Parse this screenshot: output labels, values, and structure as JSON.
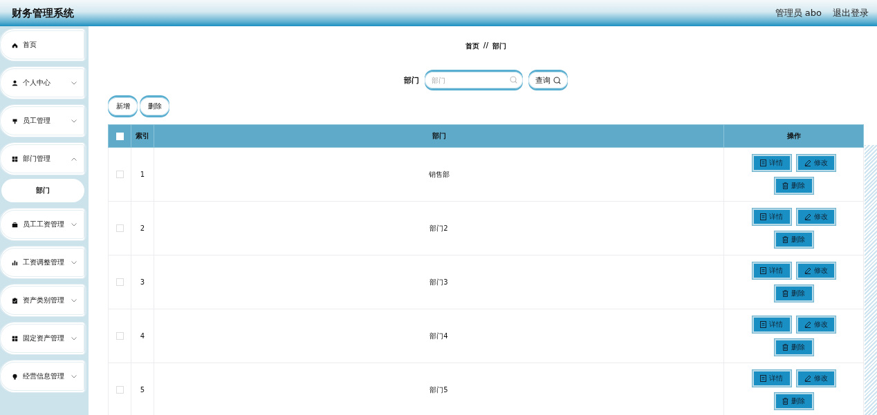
{
  "header": {
    "title": "财务管理系统",
    "user": "管理员 abo",
    "logout": "退出登录"
  },
  "sidebar": {
    "items": [
      {
        "label": "首页",
        "kind": "link",
        "selected": false
      },
      {
        "label": "个人中心",
        "kind": "group",
        "expanded": false
      },
      {
        "label": "员工管理",
        "kind": "group",
        "expanded": false
      },
      {
        "label": "部门管理",
        "kind": "group",
        "expanded": true,
        "children": [
          {
            "label": "部门",
            "selected": true
          }
        ]
      },
      {
        "label": "员工工资管理",
        "kind": "group",
        "expanded": false
      },
      {
        "label": "工资调整管理",
        "kind": "group",
        "expanded": false
      },
      {
        "label": "资产类别管理",
        "kind": "group",
        "expanded": false
      },
      {
        "label": "固定资产管理",
        "kind": "group",
        "expanded": false
      },
      {
        "label": "经营信息管理",
        "kind": "group",
        "expanded": false
      }
    ]
  },
  "breadcrumb": [
    "首页",
    "//",
    "部门"
  ],
  "search": {
    "label": "部门",
    "placeholder": "部门",
    "button": "查询"
  },
  "toolbar": [
    "新增",
    "删除"
  ],
  "table": {
    "header_checked": false,
    "columns": [
      "索引",
      "部门",
      "操作"
    ],
    "rows": [
      {
        "checked": false,
        "index": "1",
        "name": "销售部",
        "actions": [
          "详情",
          "修改",
          "删除"
        ]
      },
      {
        "checked": false,
        "index": "2",
        "name": "部门2",
        "actions": [
          "详情",
          "修改",
          "删除"
        ]
      },
      {
        "checked": false,
        "index": "3",
        "name": "部门3",
        "actions": [
          "详情",
          "修改",
          "删除"
        ]
      },
      {
        "checked": false,
        "index": "4",
        "name": "部门4",
        "actions": [
          "详情",
          "修改",
          "删除"
        ]
      },
      {
        "checked": false,
        "index": "5",
        "name": "部门5",
        "actions": [
          "详情",
          "修改",
          "删除"
        ]
      }
    ]
  }
}
